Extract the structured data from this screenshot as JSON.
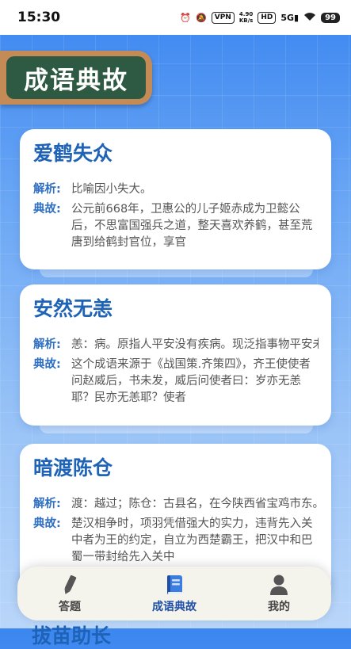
{
  "status": {
    "time": "15:30",
    "vpn": "VPN",
    "speed_value": "4.90",
    "speed_unit": "KB/s",
    "hd": "HD",
    "signal": "5G",
    "battery": "99"
  },
  "header": {
    "title": "成语典故"
  },
  "labels": {
    "meaning": "解析:",
    "story": "典故:"
  },
  "idioms": [
    {
      "title": "爱鹤失众",
      "meaning": "比喻因小失大。",
      "story": "公元前668年，卫惠公的儿子姬赤成为卫懿公后，不思富国强兵之道，整天喜欢养鹤，甚至荒唐到给鹤封官位，享官"
    },
    {
      "title": "安然无恙",
      "meaning": "恙：病。原指人平安没有疾病。现泛指事物平安未遭损害。",
      "story": "这个成语来源于《战国策.齐策四》，齐王使使者问赵威后，书未发，威后问使者曰：岁亦无恙耶？民亦无恙耶？使者"
    },
    {
      "title": "暗渡陈仓",
      "meaning": "渡：越过；陈仓：古县名，在今陕西省宝鸡市东。",
      "story": "楚汉相争时，项羽凭借强大的实力，违背先入关中者为王的约定，自立为西楚霸王，把汉中和巴蜀一带封给先入关中"
    }
  ],
  "peek_title": "拔苗助长",
  "nav": [
    {
      "label": "答题",
      "icon": "pencil-icon",
      "active": false
    },
    {
      "label": "成语典故",
      "icon": "book-icon",
      "active": true
    },
    {
      "label": "我的",
      "icon": "user-icon",
      "active": false
    }
  ],
  "colors": {
    "accent": "#1f63b7",
    "board_wood": "#c58b57",
    "board_green": "#2e5a43"
  }
}
